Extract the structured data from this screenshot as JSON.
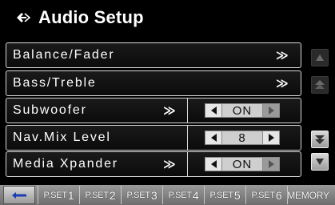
{
  "header": {
    "title": "Audio Setup",
    "icon": "hand-pointer-icon"
  },
  "menu": {
    "items": [
      {
        "label": "Balance/Fader",
        "chevron": "≫"
      },
      {
        "label": "Bass/Treble",
        "chevron": "≫"
      },
      {
        "label": "Subwoofer",
        "chevron": "≫",
        "value": "ON"
      },
      {
        "label": "Nav.Mix Level",
        "value": "8"
      },
      {
        "label": "Media Xpander",
        "chevron": "≫",
        "value": "ON"
      }
    ]
  },
  "bottombar": {
    "presets": [
      {
        "prefix": "P.SET",
        "num": "1"
      },
      {
        "prefix": "P.SET",
        "num": "2"
      },
      {
        "prefix": "P.SET",
        "num": "3"
      },
      {
        "prefix": "P.SET",
        "num": "4"
      },
      {
        "prefix": "P.SET",
        "num": "5"
      },
      {
        "prefix": "P.SET",
        "num": "6"
      }
    ],
    "memory": "MEMORY"
  },
  "colors": {
    "background": "#000000",
    "row_border": "#d8d8d8",
    "stepper_button": "#e6e6e6",
    "stepper_value": "#cfcfcf",
    "bottombar": "#8a8a8a"
  }
}
